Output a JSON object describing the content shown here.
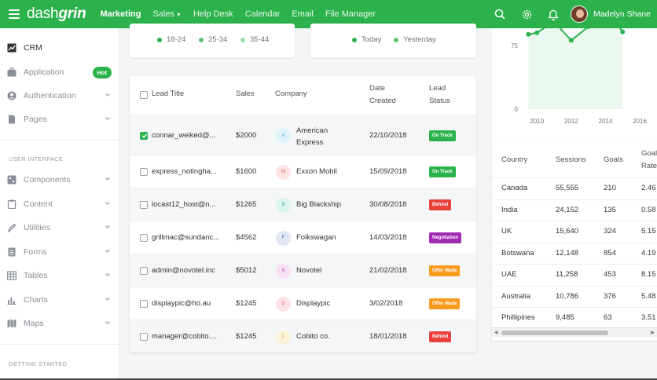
{
  "brand": {
    "prefix": "dash",
    "suffix": "grin"
  },
  "nav": {
    "items": [
      {
        "label": "Marketing"
      },
      {
        "label": "Sales"
      },
      {
        "label": "Help Desk"
      },
      {
        "label": "Calendar"
      },
      {
        "label": "Email"
      },
      {
        "label": "File Manager"
      }
    ],
    "user_name": "Madelyn Shane"
  },
  "sidebar": {
    "items": [
      {
        "label": "CRM",
        "icon": "chart-square-icon"
      },
      {
        "label": "Application",
        "icon": "briefcase-icon",
        "badge": "Hot"
      },
      {
        "label": "Authentication",
        "icon": "user-circle-icon"
      },
      {
        "label": "Pages",
        "icon": "file-icon"
      },
      {
        "label": "Components",
        "icon": "puzzle-icon"
      },
      {
        "label": "Content",
        "icon": "clipboard-icon"
      },
      {
        "label": "Utilities",
        "icon": "pen-icon"
      },
      {
        "label": "Forms",
        "icon": "form-icon"
      },
      {
        "label": "Tables",
        "icon": "table-icon"
      },
      {
        "label": "Charts",
        "icon": "bar-chart-icon"
      },
      {
        "label": "Maps",
        "icon": "map-icon"
      }
    ],
    "section_ui": "USER INTERFACE",
    "section_started": "GETTING STARTED"
  },
  "age_legend": [
    {
      "label": "18-24",
      "color": "#2bb24c"
    },
    {
      "label": "25-34",
      "color": "#5bc46b"
    },
    {
      "label": "35-44",
      "color": "#9edba8"
    }
  ],
  "day_legend": [
    {
      "label": "Today",
      "color": "#2bb24c"
    },
    {
      "label": "Yesterday",
      "color": "#5bc46b"
    }
  ],
  "leads": {
    "headers": {
      "title": "Lead Title",
      "sales": "Sales",
      "company": "Company",
      "date_l1": "Date",
      "date_l2": "Created",
      "status_l1": "Lead",
      "status_l2": "Status"
    },
    "rows": [
      {
        "checked": true,
        "title": "connar_weiked@...",
        "sales": "$2000",
        "initial": "A",
        "company_l1": "American",
        "company_l2": "Express",
        "date": "22/10/2018",
        "status": "On Track",
        "status_color": "#2bb24c",
        "icon_bg": "#dff3fb",
        "icon_fg": "#3aaed8"
      },
      {
        "checked": false,
        "title": "express_notingha...",
        "sales": "$1600",
        "initial": "M",
        "company_l1": "Exxon Mobil",
        "company_l2": "",
        "date": "15/09/2018",
        "status": "On Track",
        "status_color": "#2bb24c",
        "icon_bg": "#fde3e6",
        "icon_fg": "#e25a6e"
      },
      {
        "checked": false,
        "title": "locast12_host@n...",
        "sales": "$1265",
        "initial": "B",
        "company_l1": "Big Blackship",
        "company_l2": "",
        "date": "30/08/2018",
        "status": "Behind",
        "status_color": "#e8413c",
        "icon_bg": "#dcf3ee",
        "icon_fg": "#3ab095"
      },
      {
        "checked": false,
        "title": "grillmac@sundanc...",
        "sales": "$4562",
        "initial": "F",
        "company_l1": "Folkswagan",
        "company_l2": "",
        "date": "14/03/2018",
        "status": "Negotiation",
        "status_color": "#a12bb2",
        "icon_bg": "#e3e6f5",
        "icon_fg": "#5a6bc0"
      },
      {
        "checked": false,
        "title": "admin@novotel.inc",
        "sales": "$5012",
        "initial": "N",
        "company_l1": "Novotel",
        "company_l2": "",
        "date": "21/02/2018",
        "status": "Offer Made",
        "status_color": "#f79a1e",
        "icon_bg": "#f7e0f2",
        "icon_fg": "#c04aa5"
      },
      {
        "checked": false,
        "title": "displaypic@ho.au",
        "sales": "$1245",
        "initial": "D",
        "company_l1": "Displaypic",
        "company_l2": "",
        "date": "3/02/2018",
        "status": "Offer Made",
        "status_color": "#f79a1e",
        "icon_bg": "#fde3e6",
        "icon_fg": "#e25a6e"
      },
      {
        "checked": false,
        "title": "manager@cobito....",
        "sales": "$1245",
        "initial": "C",
        "company_l1": "Cobito co.",
        "company_l2": "",
        "date": "18/01/2018",
        "status": "Behind",
        "status_color": "#e8413c",
        "icon_bg": "#fdf3dc",
        "icon_fg": "#e3a83a"
      }
    ]
  },
  "chart_data": {
    "type": "line",
    "x": [
      2009.5,
      2010,
      2011,
      2012,
      2013,
      2014,
      2015
    ],
    "values": [
      88,
      90,
      103,
      81,
      97,
      120,
      91
    ],
    "xticks": [
      "2010",
      "2012",
      "2014",
      "2016"
    ],
    "yticks": [
      "0",
      "75"
    ],
    "ylim": [
      0,
      110
    ],
    "xlim": [
      2009.3,
      2016
    ],
    "color": "#2bb24c"
  },
  "sessions": {
    "headers": {
      "country": "Country",
      "sessions": "Sessions",
      "goals": "Goals",
      "rate_l1": "Goal",
      "rate_l2": "Rate"
    },
    "rows": [
      {
        "country": "Canada",
        "sessions": "55,555",
        "goals": "210",
        "rate": "2.46"
      },
      {
        "country": "India",
        "sessions": "24,152",
        "goals": "135",
        "rate": "0.58"
      },
      {
        "country": "UK",
        "sessions": "15,640",
        "goals": "324",
        "rate": "5.15"
      },
      {
        "country": "Botswana",
        "sessions": "12,148",
        "goals": "854",
        "rate": "4.19"
      },
      {
        "country": "UAE",
        "sessions": "11,258",
        "goals": "453",
        "rate": "8.15"
      },
      {
        "country": "Australia",
        "sessions": "10,786",
        "goals": "376",
        "rate": "5.48"
      },
      {
        "country": "Phillipines",
        "sessions": "9,485",
        "goals": "63",
        "rate": "3.51"
      }
    ]
  }
}
